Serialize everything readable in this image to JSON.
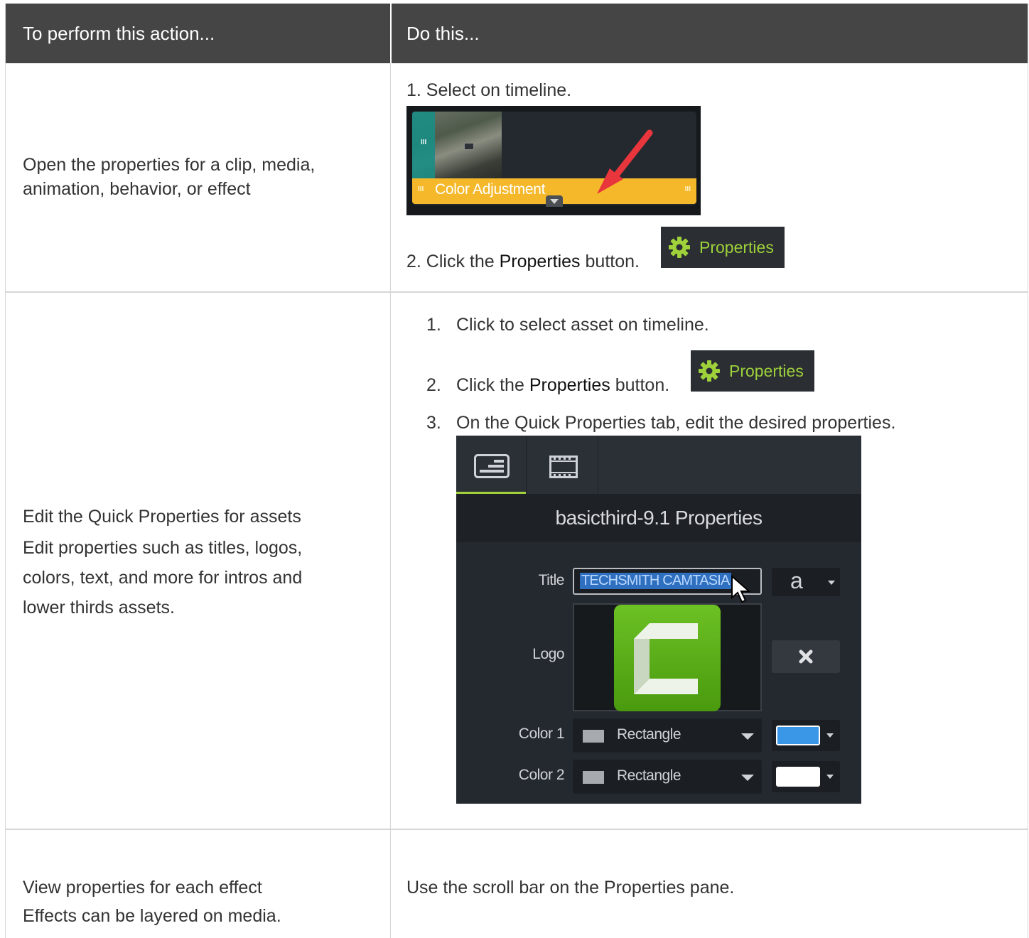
{
  "table": {
    "headers": [
      "To perform this action...",
      "Do this..."
    ],
    "rows": [
      {
        "action": "Open the properties for a clip, media, animation, behavior, or effect",
        "step1": "1. Select on timeline.",
        "step2_prefix": "2. Click the ",
        "step2_bold": "Properties",
        "step2_suffix": " button.",
        "timeline_clip_label": "Color Adjustment"
      },
      {
        "action_lines": [
          "Edit the Quick Properties for assets",
          "Edit properties such as titles, logos,",
          "colors, text, and more for intros and",
          "lower thirds assets."
        ],
        "steps": [
          {
            "num": "1.",
            "text": "Click to select asset on timeline."
          },
          {
            "num": "2.",
            "prefix": "Click the ",
            "bold": "Properties",
            "suffix": " button."
          },
          {
            "num": "3.",
            "text": "On the Quick Properties tab, edit the desired properties."
          }
        ]
      },
      {
        "action_lines": [
          "View properties for each effect",
          "Effects can be layered on media."
        ],
        "do": "Use the scroll bar on the Properties pane."
      }
    ]
  },
  "properties_button_label": "Properties",
  "quick_properties": {
    "title": "basicthird-9.1 Properties",
    "fields": {
      "title_label": "Title",
      "title_value": "TECHSMITH CAMTASIA",
      "font_glyph": "a",
      "logo_label": "Logo",
      "color1_label": "Color 1",
      "color1_shape": "Rectangle",
      "color1_swatch": "#3a96e6",
      "color2_label": "Color 2",
      "color2_shape": "Rectangle",
      "color2_swatch": "#ffffff"
    }
  },
  "colors": {
    "header_bg": "#454545",
    "accent_green": "#9ed13a",
    "clip_yellow": "#f5b82a",
    "arrow_red": "#e8363c"
  }
}
